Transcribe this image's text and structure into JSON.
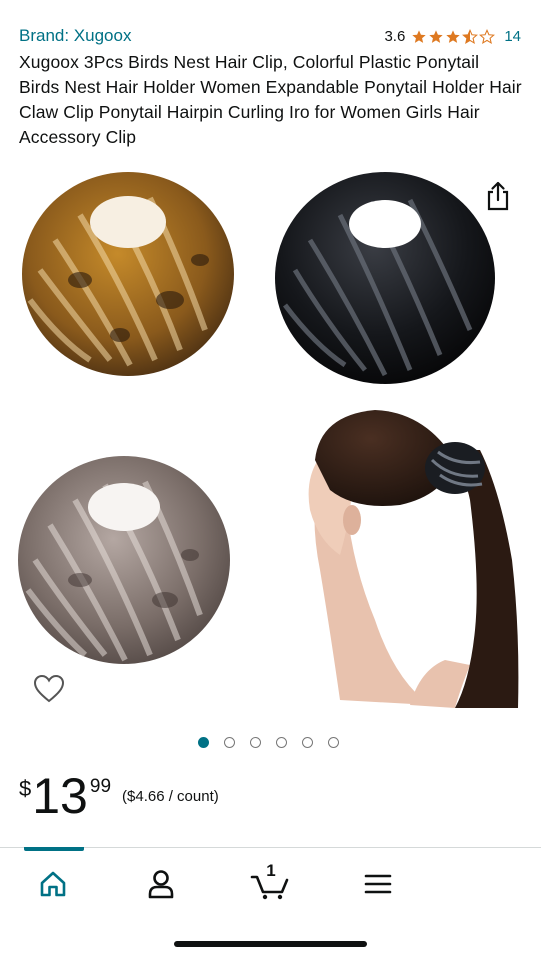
{
  "product": {
    "brand": "Brand: Xugoox",
    "rating": "3.6",
    "rating_value": 3.6,
    "rating_count": "14",
    "title": "Xugoox 3Pcs Birds Nest Hair Clip, Colorful Plastic Ponytail Birds Nest Hair Holder Women Expandable Ponytail Holder Hair Claw Clip Ponytail Hairpin Curling Iro for Women Girls Hair Accessory Clip"
  },
  "gallery": {
    "total_images": 6,
    "current_index": 0
  },
  "price": {
    "symbol": "$",
    "whole": "13",
    "fraction": "99",
    "per_unit": "($4.66 / count)"
  },
  "tabbar": {
    "cart_count": "1"
  },
  "colors": {
    "link": "#007185",
    "star": "#de7921",
    "text": "#0f1111"
  }
}
